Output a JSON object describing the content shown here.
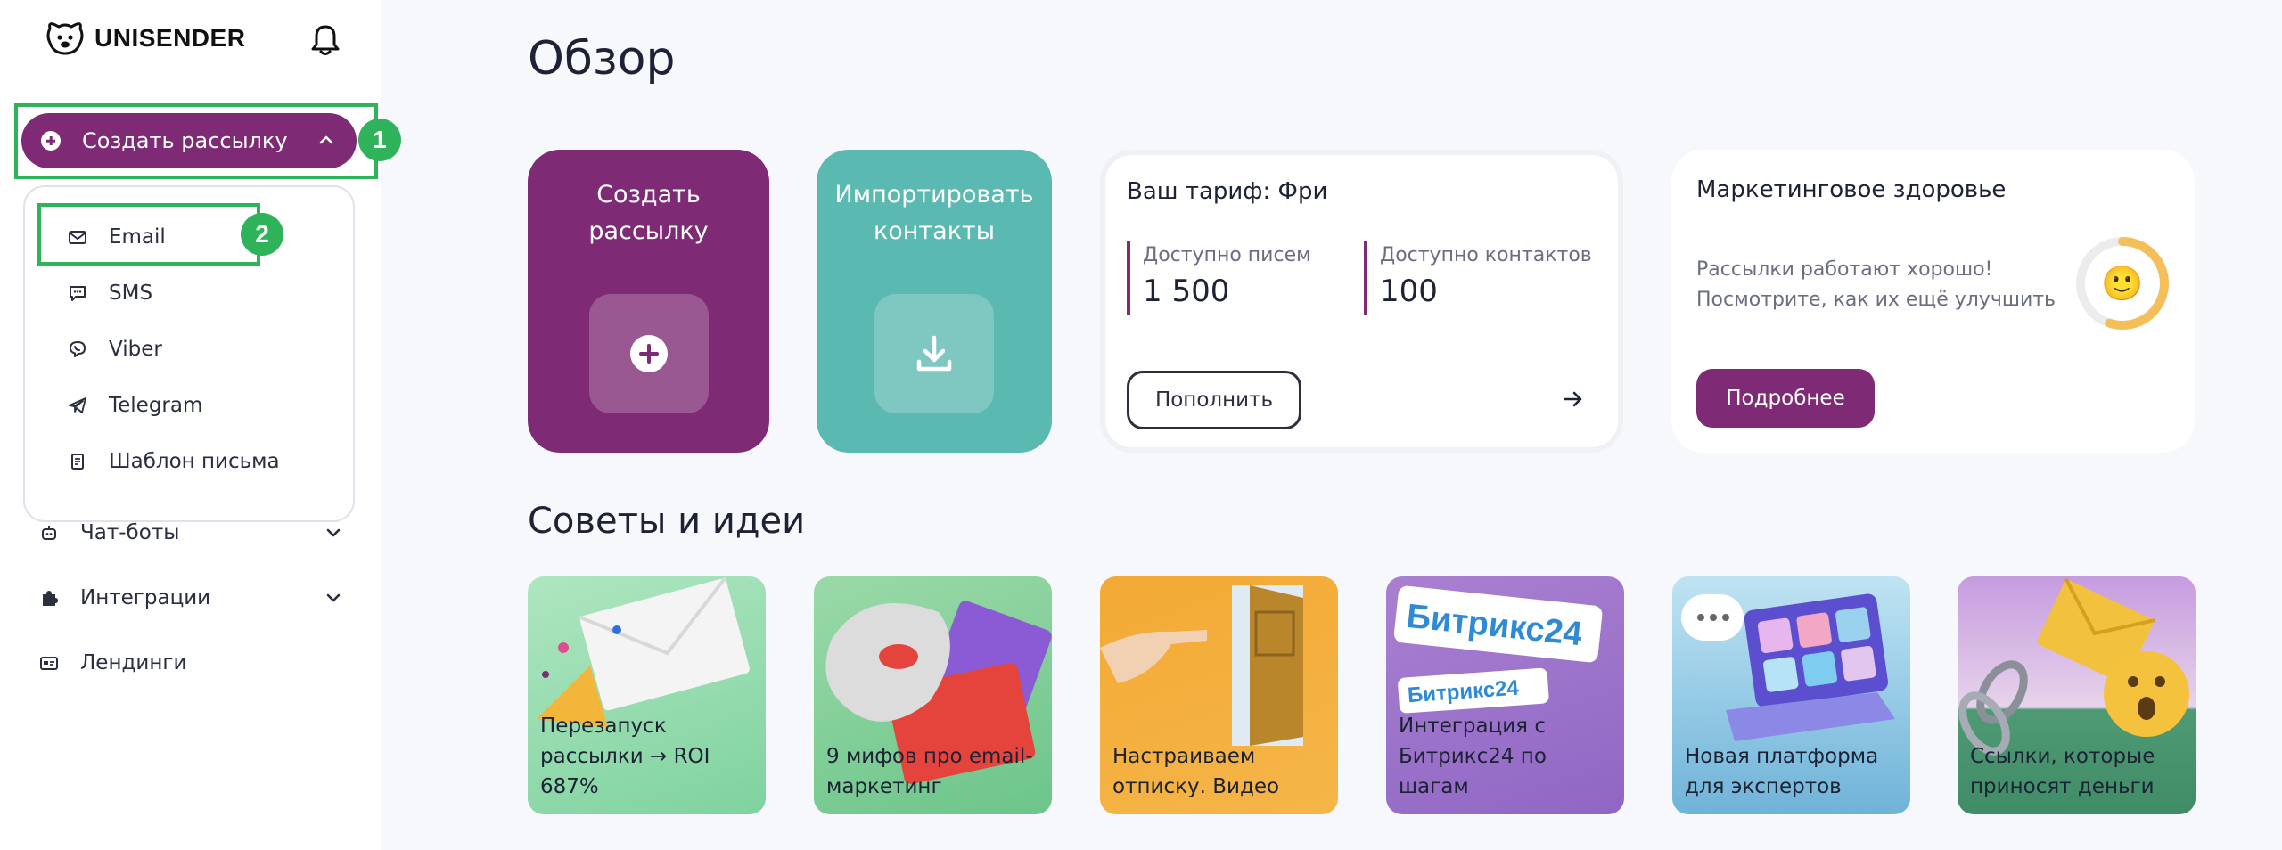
{
  "brand": {
    "name": "UNISENDER"
  },
  "sidebar": {
    "create_button": "Создать рассылку",
    "badges": [
      "1",
      "2"
    ],
    "dropdown": [
      {
        "label": "Email",
        "icon": "mail-icon"
      },
      {
        "label": "SMS",
        "icon": "chat-icon"
      },
      {
        "label": "Viber",
        "icon": "viber-icon"
      },
      {
        "label": "Telegram",
        "icon": "telegram-icon"
      },
      {
        "label": "Шаблон письма",
        "icon": "template-icon"
      }
    ],
    "links": [
      {
        "label": "Чат-боты",
        "icon": "bot-icon"
      },
      {
        "label": "Интеграции",
        "icon": "puzzle-icon"
      },
      {
        "label": "Лендинги",
        "icon": "landing-icon"
      }
    ]
  },
  "main": {
    "title": "Обзор",
    "cards": {
      "create": {
        "line1": "Создать",
        "line2": "рассылку"
      },
      "import": {
        "line1": "Импортировать",
        "line2": "контакты"
      },
      "tariff": {
        "title": "Ваш тариф: Фри",
        "letters_label": "Доступно писем",
        "letters_value": "1 500",
        "contacts_label": "Доступно контактов",
        "contacts_value": "100",
        "topup_label": "Пополнить"
      },
      "health": {
        "title": "Маркетинговое здоровье",
        "text_line1": "Рассылки работают хорошо!",
        "text_line2": "Посмотрите, как их ещё улучшить",
        "more_label": "Подробнее",
        "emoji": "🙂",
        "score_fraction": 0.55
      }
    },
    "tips_title": "Советы и идеи",
    "tips": [
      {
        "line1": "Перезапуск",
        "line2": "рассылки → ROI",
        "line3": "687%"
      },
      {
        "line1": "9 мифов про email-",
        "line2": "маркетинг"
      },
      {
        "line1": "Настраиваем",
        "line2": "отписку. Видео"
      },
      {
        "line1": "Интеграция с",
        "line2": "Битрикс24 по шагам",
        "brand_text": "Битрикс24"
      },
      {
        "line1": "Новая платформа",
        "line2": "для экспертов"
      },
      {
        "line1": "Ссылки, которые",
        "line2": "приносят деньги"
      }
    ]
  },
  "colors": {
    "accent": "#7e2a75",
    "teal": "#5ab9b0",
    "highlight": "#2fb35a"
  }
}
